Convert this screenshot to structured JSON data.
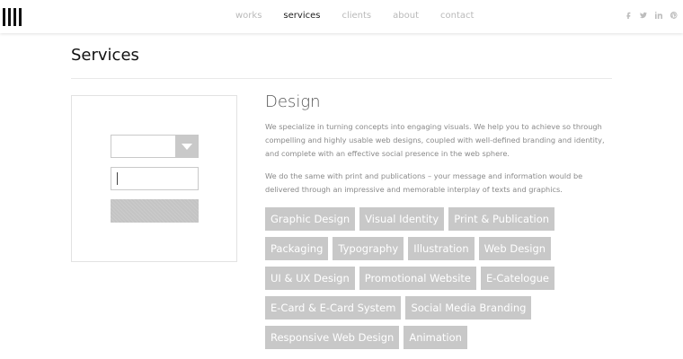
{
  "header": {
    "nav": [
      {
        "label": "works",
        "active": false
      },
      {
        "label": "services",
        "active": true
      },
      {
        "label": "clients",
        "active": false
      },
      {
        "label": "about",
        "active": false
      },
      {
        "label": "contact",
        "active": false
      }
    ],
    "social_icons": [
      "facebook-icon",
      "twitter-icon",
      "linkedin-icon",
      "pinterest-icon"
    ]
  },
  "page": {
    "title": "Services"
  },
  "sidebar_form": {
    "select_value": "",
    "input_value": "",
    "submit_label": ""
  },
  "content": {
    "heading": "Design",
    "paragraph_1": "We specialize in turning concepts into engaging visuals. We help you to achieve so through compelling and highly usable web designs, coupled with well-defined branding and identity, and complete with an effective social presence in the web sphere.",
    "paragraph_2": "We do the same with print and publications – your message and information would be delivered through an impressive and memorable interplay of texts and graphics.",
    "tags": [
      [
        "Graphic Design",
        "Visual Identity",
        "Print & Publication"
      ],
      [
        "Packaging",
        "Typography",
        "Illustration",
        "Web Design"
      ],
      [
        "UI & UX Design",
        "Promotional Website",
        "E-Catelogue"
      ],
      [
        "E-Card & E-Card System",
        "Social Media Branding"
      ],
      [
        "Responsive Web Design",
        "Animation"
      ]
    ]
  },
  "colors": {
    "tag_bg": "#c8c8c8",
    "nav_active": "#222222",
    "nav_inactive": "#b9b9b9"
  }
}
